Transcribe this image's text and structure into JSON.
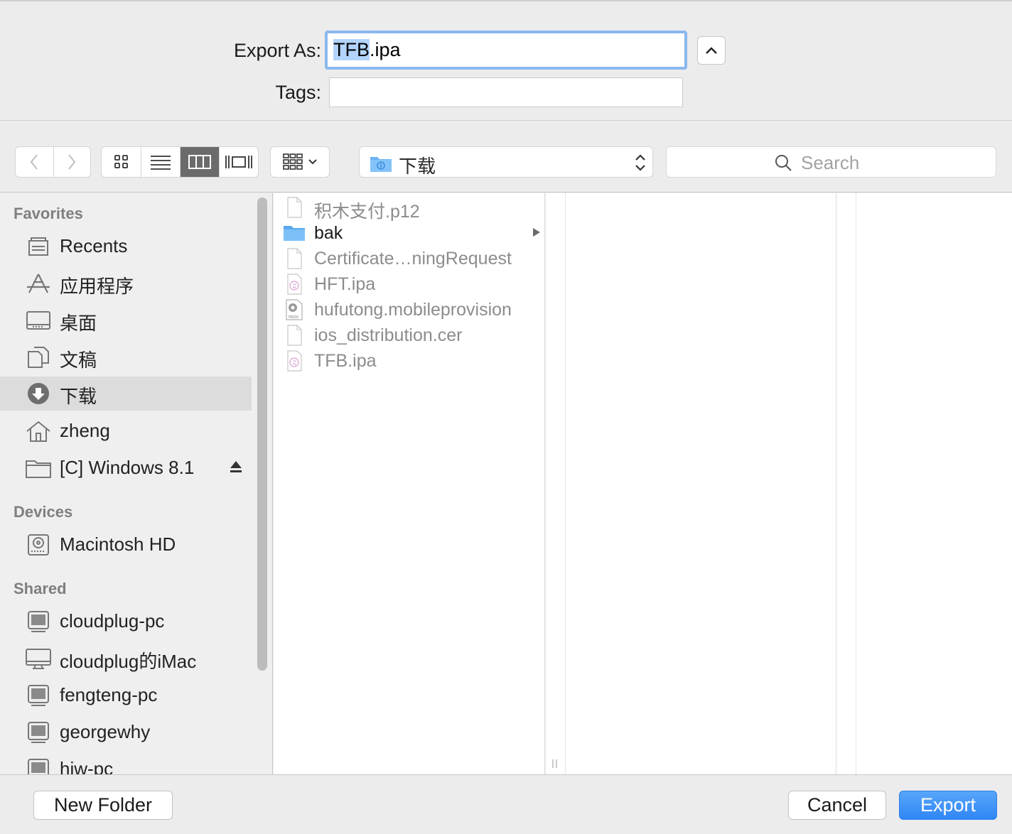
{
  "export": {
    "label": "Export As:",
    "filename_selected": "TFB",
    "filename_rest": ".ipa",
    "tags_label": "Tags:",
    "tags_value": ""
  },
  "toolbar": {
    "location": "下载",
    "search_placeholder": "Search"
  },
  "sidebar": {
    "favorites_header": "Favorites",
    "favorites": [
      {
        "label": "Recents",
        "icon": "recents-icon"
      },
      {
        "label": "应用程序",
        "icon": "applications-icon"
      },
      {
        "label": "桌面",
        "icon": "desktop-icon"
      },
      {
        "label": "文稿",
        "icon": "documents-icon"
      },
      {
        "label": "下载",
        "icon": "downloads-icon",
        "selected": true
      },
      {
        "label": "zheng",
        "icon": "home-icon"
      },
      {
        "label": "[C] Windows 8.1",
        "icon": "folder-icon"
      }
    ],
    "devices_header": "Devices",
    "devices": [
      {
        "label": "Macintosh HD",
        "icon": "hard-drive-icon"
      }
    ],
    "shared_header": "Shared",
    "shared": [
      {
        "label": "cloudplug-pc",
        "icon": "pc-icon"
      },
      {
        "label": "cloudplug的iMac",
        "icon": "imac-icon"
      },
      {
        "label": "fengteng-pc",
        "icon": "pc-icon"
      },
      {
        "label": "georgewhy",
        "icon": "pc-icon"
      },
      {
        "label": "hjw-pc",
        "icon": "pc-icon"
      }
    ]
  },
  "files": [
    {
      "name": "积木支付.p12",
      "type": "document"
    },
    {
      "name": "bak",
      "type": "folder"
    },
    {
      "name": "Certificate…ningRequest",
      "type": "document"
    },
    {
      "name": "HFT.ipa",
      "type": "ipa"
    },
    {
      "name": "hufutong.mobileprovision",
      "type": "provision"
    },
    {
      "name": "ios_distribution.cer",
      "type": "document"
    },
    {
      "name": "TFB.ipa",
      "type": "ipa"
    }
  ],
  "buttons": {
    "new_folder": "New Folder",
    "cancel": "Cancel",
    "export": "Export"
  },
  "colors": {
    "accent": "#3b8ff7",
    "selection": "#b3d4fd",
    "folder": "#6cb4f5"
  }
}
